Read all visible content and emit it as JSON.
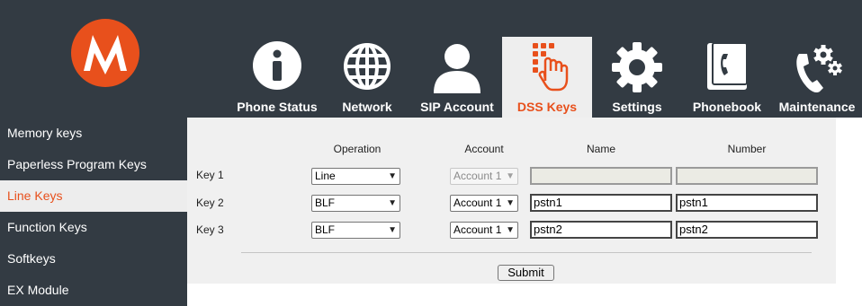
{
  "brand": {
    "accent": "#e8501c",
    "header_bg": "#333b43",
    "logo": "motorola-batwing-logo"
  },
  "nav": {
    "tabs": [
      {
        "label": "Phone Status",
        "icon": "info-icon",
        "active": false
      },
      {
        "label": "Network",
        "icon": "globe-icon",
        "active": false
      },
      {
        "label": "SIP Account",
        "icon": "user-icon",
        "active": false
      },
      {
        "label": "DSS Keys",
        "icon": "keypad-hand-icon",
        "active": true
      },
      {
        "label": "Settings",
        "icon": "gear-icon",
        "active": false
      },
      {
        "label": "Phonebook",
        "icon": "phonebook-icon",
        "active": false
      },
      {
        "label": "Maintenance",
        "icon": "phone-gears-icon",
        "active": false
      }
    ]
  },
  "sidebar": {
    "items": [
      {
        "label": "Memory keys",
        "active": false
      },
      {
        "label": "Paperless Program Keys",
        "active": false
      },
      {
        "label": "Line Keys",
        "active": true
      },
      {
        "label": "Function Keys",
        "active": false
      },
      {
        "label": "Softkeys",
        "active": false
      },
      {
        "label": "EX Module",
        "active": false
      }
    ]
  },
  "table": {
    "headers": {
      "operation": "Operation",
      "account": "Account",
      "name": "Name",
      "number": "Number"
    },
    "rows": [
      {
        "key": "Key 1",
        "operation": "Line",
        "account": "Account 1",
        "account_disabled": true,
        "name": "",
        "number": "",
        "fields_disabled": true
      },
      {
        "key": "Key 2",
        "operation": "BLF",
        "account": "Account 1",
        "account_disabled": false,
        "name": "pstn1",
        "number": "pstn1",
        "fields_disabled": false
      },
      {
        "key": "Key 3",
        "operation": "BLF",
        "account": "Account 1",
        "account_disabled": false,
        "name": "pstn2",
        "number": "pstn2",
        "fields_disabled": false
      }
    ]
  },
  "actions": {
    "submit_label": "Submit"
  }
}
